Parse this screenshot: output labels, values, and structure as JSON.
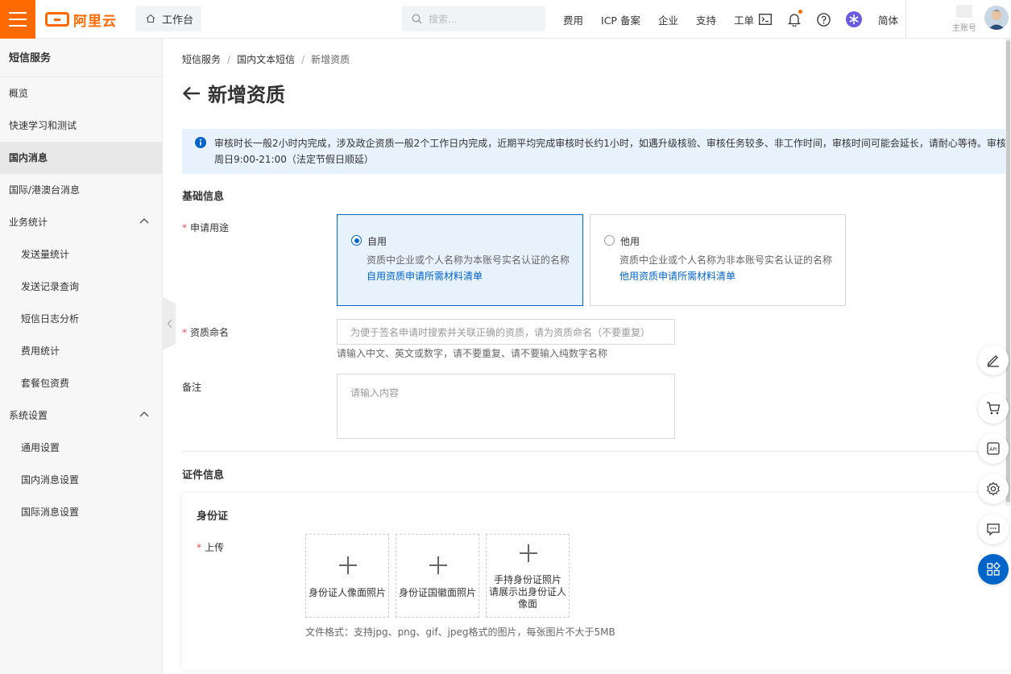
{
  "header": {
    "logo_text": "阿里云",
    "workbench_label": "工作台",
    "search_placeholder": "搜索...",
    "nav": [
      "费用",
      "ICP 备案",
      "企业",
      "支持",
      "工单"
    ],
    "lang": "简体",
    "account_label": "主账号",
    "accent": "#ff6a00"
  },
  "sidebar": {
    "title": "短信服务",
    "items": [
      {
        "label": "概览"
      },
      {
        "label": "快速学习和测试"
      },
      {
        "label": "国内消息"
      },
      {
        "label": "国际/港澳台消息"
      },
      {
        "label": "业务统计"
      },
      {
        "label": "发送量统计"
      },
      {
        "label": "发送记录查询"
      },
      {
        "label": "短信日志分析"
      },
      {
        "label": "费用统计"
      },
      {
        "label": "套餐包资费"
      },
      {
        "label": "系统设置"
      },
      {
        "label": "通用设置"
      },
      {
        "label": "国内消息设置"
      },
      {
        "label": "国际消息设置"
      }
    ]
  },
  "breadcrumb": [
    "短信服务",
    "国内文本短信",
    "新增资质"
  ],
  "page_title": "新增资质",
  "notice": {
    "line1": "审核时长一般2小时内完成，涉及政企资质一般2个工作日内完成，近期平均完成审核时长约1小时，如遇升级核验、审核任务较多、非工作时间，审核时间可能会延长，请耐心等待。审核",
    "line2": "周日9:00-21:00（法定节假日顺延）"
  },
  "basic": {
    "section_title": "基础信息",
    "purpose_label": "申请用途",
    "options": [
      {
        "title": "自用",
        "desc": "资质中企业或个人名称为本账号实名认证的名称",
        "link": "自用资质申请所需材料清单"
      },
      {
        "title": "他用",
        "desc": "资质中企业或个人名称为非本账号实名认证的名称",
        "link": "他用资质申请所需材料清单"
      }
    ],
    "name_label": "资质命名",
    "name_placeholder": "为便于签名申请时搜索并关联正确的资质，请为资质命名（不要重复）",
    "name_hint": "请输入中文、英文或数字，请不要重复、请不要输入纯数字名称",
    "remark_label": "备注",
    "remark_placeholder": "请输入内容"
  },
  "cert": {
    "section_title": "证件信息",
    "panel_title": "身份证",
    "upload_label": "上传",
    "uploads": [
      {
        "label": "身份证人像面照片"
      },
      {
        "label": "身份证国徽面照片"
      },
      {
        "label": "手持身份证照片",
        "line2": "请展示出身份证人",
        "line3": "像面"
      }
    ],
    "format_hint": "文件格式：支持jpg、png、gif、jpeg格式的图片，每张图片不大于5MB"
  },
  "float_buttons": [
    "edit-icon",
    "cart-icon",
    "api-icon",
    "gear-icon",
    "chat-icon",
    "apps-icon"
  ]
}
